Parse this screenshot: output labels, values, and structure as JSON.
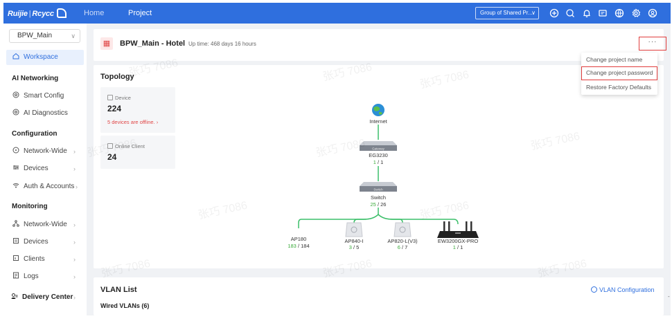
{
  "app": {
    "brand": "Ruijie",
    "brand_suffix": "Rcycc",
    "nav": {
      "home": "Home",
      "project": "Project"
    },
    "group_select": "Group of Shared Pr...",
    "top_icons": [
      "plus-circle-icon",
      "search-icon",
      "bell-icon",
      "message-icon",
      "globe-icon",
      "settings-icon",
      "user-icon"
    ],
    "accent": "#2f6fde"
  },
  "sidebar": {
    "project_select": "BPW_Main",
    "workspace": "Workspace",
    "sections": [
      {
        "heading": "AI Networking",
        "items": [
          "Smart Config",
          "AI Diagnostics"
        ]
      },
      {
        "heading": "Configuration",
        "items": [
          "Network-Wide",
          "Devices",
          "Auth & Accounts"
        ]
      },
      {
        "heading": "Monitoring",
        "items": [
          "Network-Wide",
          "Devices",
          "Clients",
          "Logs"
        ]
      }
    ],
    "delivery_center": "Delivery Center"
  },
  "project": {
    "title": "BPW_Main - Hotel",
    "uptime": "Up time: 468 days 16 hours",
    "more": "···"
  },
  "dropdown": {
    "items": [
      "Change project name",
      "Change project password",
      "Restore Factory Defaults"
    ]
  },
  "topology": {
    "title": "Topology",
    "device_label": "Device",
    "device_count": "224",
    "offline_text": "5 devices are offline. ›",
    "client_label": "Online Client",
    "client_count": "24",
    "nodes": {
      "internet": "Internet",
      "gateway": {
        "name": "EG3230",
        "online": "1",
        "total": "1",
        "chassis_label": "Gateway"
      },
      "switch": {
        "name": "Switch",
        "online": "25",
        "total": "26",
        "chassis_label": "Switch"
      },
      "aps": [
        {
          "name": "AP180",
          "online": "183",
          "total": "184"
        },
        {
          "name": "AP840-I",
          "online": "3",
          "total": "5"
        },
        {
          "name": "AP820-L(V3)",
          "online": "6",
          "total": "7"
        },
        {
          "name": "EW3200GX-PRO",
          "online": "1",
          "total": "1"
        }
      ],
      "separator": "/"
    }
  },
  "vlan": {
    "title": "VLAN List",
    "config_link": "VLAN Configuration",
    "wired": "Wired VLANs (6)"
  },
  "watermark_text": "张巧 7086",
  "corner_mark": "-"
}
